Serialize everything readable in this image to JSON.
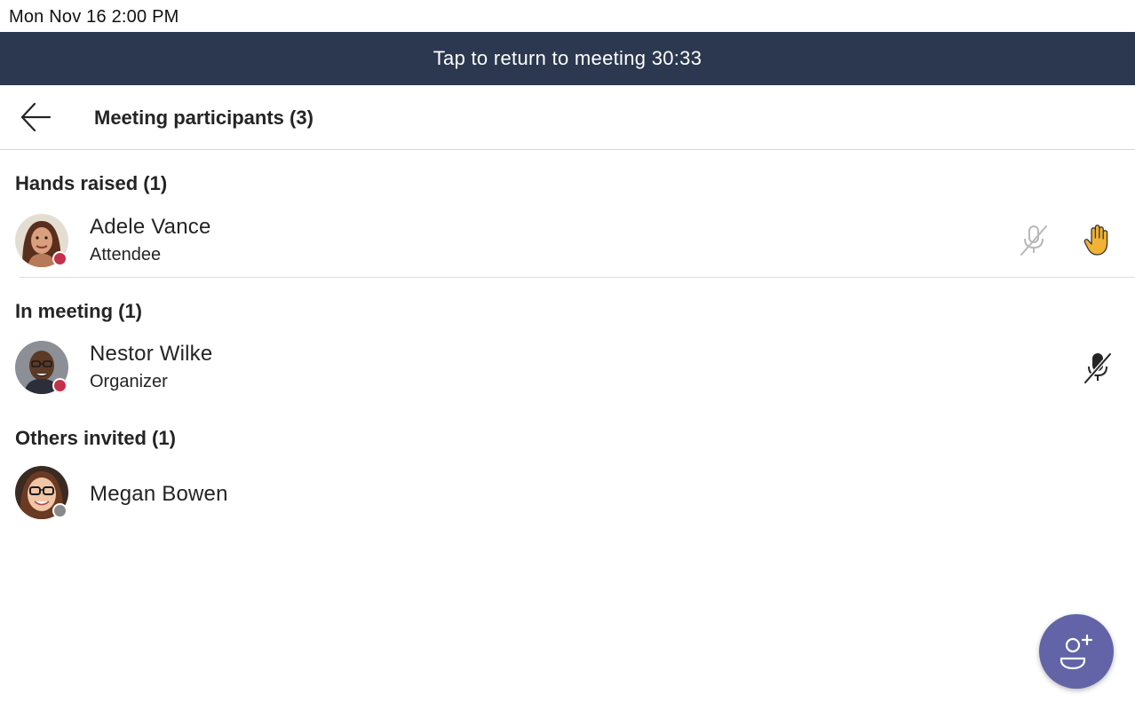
{
  "status_bar": {
    "time": "Mon Nov 16  2:00 PM"
  },
  "banner": {
    "text": "Tap to return to meeting 30:33"
  },
  "header": {
    "title": "Meeting participants (3)",
    "back_icon": "arrow-left-icon"
  },
  "sections": [
    {
      "title": "Hands raised (1)",
      "participants": [
        {
          "name": "Adele Vance",
          "role": "Attendee",
          "presence": "busy",
          "mic": "muted-disabled",
          "hand_raised": true
        }
      ]
    },
    {
      "title": "In meeting (1)",
      "participants": [
        {
          "name": "Nestor Wilke",
          "role": "Organizer",
          "presence": "busy",
          "mic": "muted",
          "hand_raised": false
        }
      ]
    },
    {
      "title": "Others invited (1)",
      "participants": [
        {
          "name": "Megan Bowen",
          "role": "",
          "presence": "offline"
        }
      ]
    }
  ],
  "fab": {
    "icon": "add-person-icon"
  },
  "colors": {
    "banner": "#2b384f",
    "fab": "#6264a7",
    "presence_busy": "#c4314b",
    "presence_offline": "#8a8a8a",
    "raised_hand": "#f2b233"
  }
}
